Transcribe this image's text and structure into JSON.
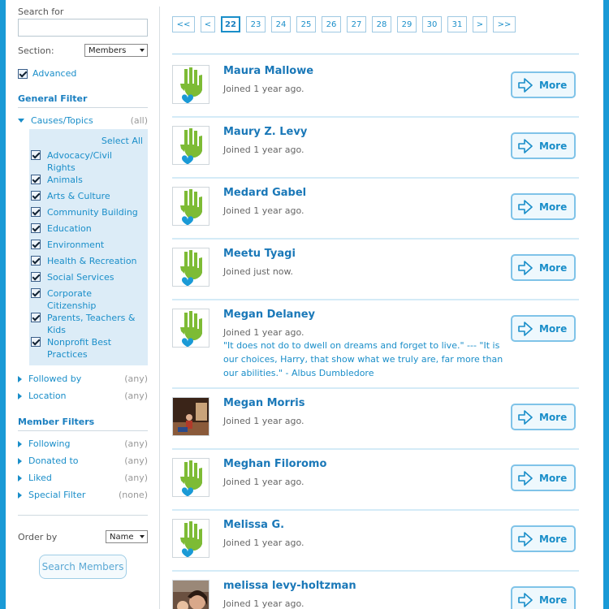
{
  "sidebar": {
    "search_label": "Search for",
    "search_value": "",
    "section_label": "Section:",
    "section_value": "Members",
    "advanced_label": "Advanced",
    "general_filter_title": "General Filter",
    "causes": {
      "label": "Causes/Topics",
      "value": "(all)"
    },
    "select_all": "Select All",
    "topics": [
      "Advocacy/Civil Rights",
      "Animals",
      "Arts & Culture",
      "Community Building",
      "Education",
      "Environment",
      "Health & Recreation",
      "Social Services",
      "Corporate Citizenship",
      "Parents, Teachers & Kids",
      "Nonprofit Best Practices"
    ],
    "general_filters": [
      {
        "label": "Followed by",
        "value": "(any)"
      },
      {
        "label": "Location",
        "value": "(any)"
      }
    ],
    "member_filters_title": "Member Filters",
    "member_filters": [
      {
        "label": "Following",
        "value": "(any)"
      },
      {
        "label": "Donated to",
        "value": "(any)"
      },
      {
        "label": "Liked",
        "value": "(any)"
      },
      {
        "label": "Special Filter",
        "value": "(none)"
      }
    ],
    "order_label": "Order by",
    "order_value": "Name",
    "search_button": "Search Members"
  },
  "pagination": {
    "first": "<<",
    "prev": "<",
    "pages": [
      "22",
      "23",
      "24",
      "25",
      "26",
      "27",
      "28",
      "29",
      "30",
      "31"
    ],
    "current": "22",
    "next": ">",
    "last": ">>"
  },
  "members": [
    {
      "name": "Maura Mallowe",
      "joined": "Joined 1 year ago.",
      "avatar": "default-logo"
    },
    {
      "name": "Maury Z. Levy",
      "joined": "Joined 1 year ago.",
      "avatar": "default-logo"
    },
    {
      "name": "Medard Gabel",
      "joined": "Joined 1 year ago.",
      "avatar": "default-logo"
    },
    {
      "name": "Meetu Tyagi",
      "joined": "Joined just now.",
      "avatar": "default-logo"
    },
    {
      "name": "Megan Delaney",
      "joined": "Joined 1 year ago.",
      "avatar": "default-logo",
      "quote": "\"It does not do to dwell on dreams and forget to live.\" --- \"It is our choices, Harry, that show what we truly are, far more than our abilities.\" - Albus Dumbledore"
    },
    {
      "name": "Megan Morris",
      "joined": "Joined 1 year ago.",
      "avatar": "photo"
    },
    {
      "name": "Meghan Filoromo",
      "joined": "Joined 1 year ago.",
      "avatar": "default-logo"
    },
    {
      "name": "Melissa G.",
      "joined": "Joined 1 year ago.",
      "avatar": "default-logo"
    },
    {
      "name": "melissa levy-holtzman",
      "joined": "Joined 1 year ago.",
      "avatar": "photo"
    }
  ],
  "more_label": "More",
  "colors": {
    "accent": "#1a9ad6",
    "link": "#1a8ec9",
    "logo_green": "#7dbb35",
    "logo_blue": "#1a9ad6"
  }
}
